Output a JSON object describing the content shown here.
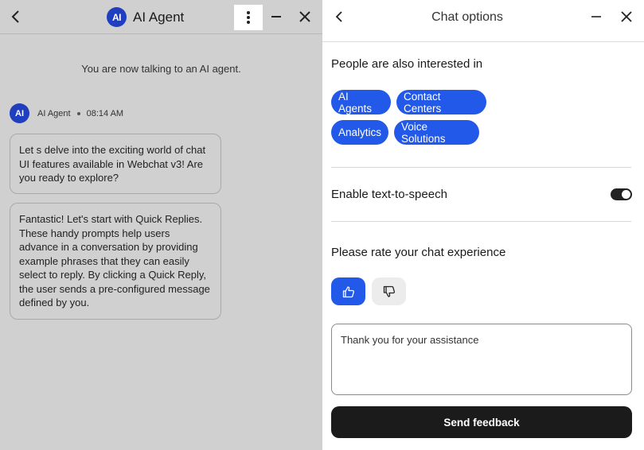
{
  "left_panel": {
    "header": {
      "logo_text": "AI",
      "title": "AI Agent"
    },
    "system_message": "You are now talking to an AI agent.",
    "sender": {
      "avatar_text": "AI",
      "name": "AI Agent",
      "time": "08:14 AM"
    },
    "messages": [
      {
        "text": "Let s delve into the exciting world of chat UI features available in Webchat v3! Are you ready to explore?"
      },
      {
        "text": "Fantastic! Let's start with Quick Replies. These handy prompts help users advance in a conversation by providing example phrases that they can easily select to reply. By clicking a Quick Reply, the user sends a pre-configured message defined by you."
      }
    ]
  },
  "right_panel": {
    "header": {
      "title": "Chat options"
    },
    "interests": {
      "title": "People are also interested in",
      "chips": [
        "AI Agents",
        "Contact Centers",
        "Analytics",
        "Voice Solutions"
      ]
    },
    "tts": {
      "label": "Enable text-to-speech",
      "enabled": true
    },
    "rating": {
      "label": "Please rate your chat experience",
      "selected": "thumbs-up"
    },
    "feedback": {
      "value": "Thank you for your assistance",
      "button_label": "Send feedback"
    }
  },
  "colors": {
    "accent": "#2359e8",
    "logo": "#1f3fbf",
    "button_dark": "#1b1b1b",
    "left_bg": "#d0d0d0"
  }
}
